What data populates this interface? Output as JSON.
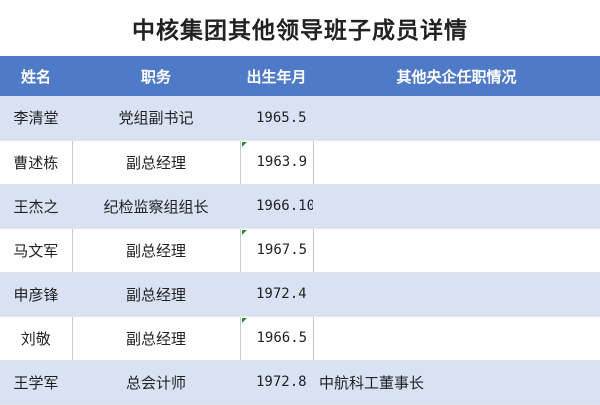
{
  "title": "中核集团其他领导班子成员详情",
  "table": {
    "headers": [
      "姓名",
      "职务",
      "出生年月",
      "其他央企任职情况"
    ],
    "rows": [
      {
        "name": "李清堂",
        "position": "党组副书记",
        "birth": "1965.5",
        "other": ""
      },
      {
        "name": "曹述栋",
        "position": "副总经理",
        "birth": "1963.9",
        "other": ""
      },
      {
        "name": "王杰之",
        "position": "纪检监察组组长",
        "birth": "1966.10",
        "other": ""
      },
      {
        "name": "马文军",
        "position": "副总经理",
        "birth": "1967.5",
        "other": ""
      },
      {
        "name": "申彦锋",
        "position": "副总经理",
        "birth": "1972.4",
        "other": ""
      },
      {
        "name": "刘敬",
        "position": "副总经理",
        "birth": "1966.5",
        "other": ""
      },
      {
        "name": "王学军",
        "position": "总会计师",
        "birth": "1972.8",
        "other": "中航科工董事长"
      }
    ]
  },
  "colors": {
    "header_bg": "#4f7ac8",
    "shade_row": "#d9e2f3",
    "marker": "#2e8b3a"
  }
}
